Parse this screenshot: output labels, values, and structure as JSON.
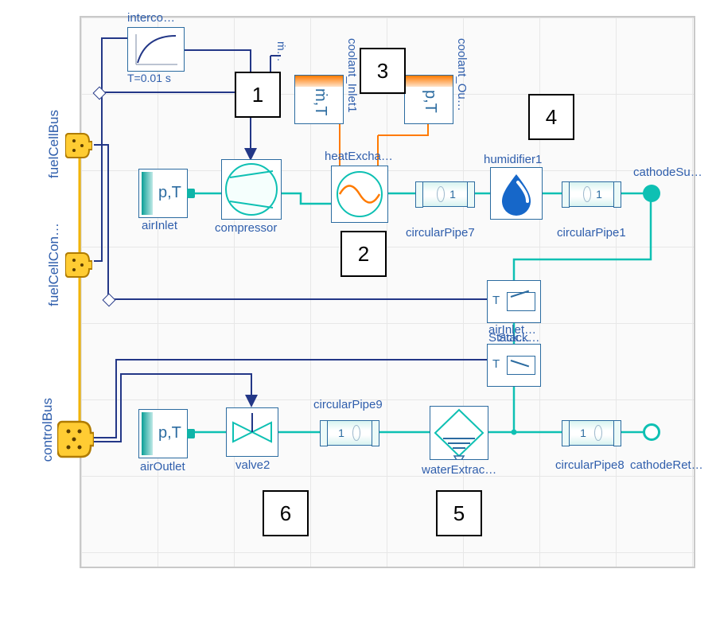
{
  "buses": {
    "fuelCellBus": "fuelCellBus",
    "fuelCellCon": "fuelCellCon…",
    "controlBus": "controlBus"
  },
  "blocks": {
    "interco": {
      "label": "interco…",
      "sub": "T=0.01 s"
    },
    "airInlet": {
      "label": "airInlet",
      "text": "p,T"
    },
    "compressor": {
      "label": "compressor"
    },
    "coolantInlet1": {
      "label": "coolant_Inlet1",
      "text": "ṁ,T",
      "shortText": "ṁ…"
    },
    "coolantOut": {
      "label": "coolant_Ou…",
      "text": "p,T"
    },
    "heatExcha": {
      "label": "heatExcha…"
    },
    "circularPipe7": {
      "label": "circularPipe7",
      "n": "1"
    },
    "humidifier1": {
      "label": "humidifier1"
    },
    "circularPipe1": {
      "label": "circularPipe1",
      "n": "1"
    },
    "cathodeSu": {
      "label": "cathodeSu…"
    },
    "airInletSensor": {
      "label": "airInlet…",
      "T": "T"
    },
    "stackSensor": {
      "label": "Stack…",
      "T": "T"
    },
    "airOutlet": {
      "label": "airOutlet",
      "text": "p,T"
    },
    "valve2": {
      "label": "valve2"
    },
    "circularPipe9": {
      "label": "circularPipe9",
      "n": "1"
    },
    "waterExtrac": {
      "label": "waterExtrac…"
    },
    "circularPipe8": {
      "label": "circularPipe8",
      "n": "1"
    },
    "cathodeRet": {
      "label": "cathodeRet…"
    }
  },
  "annotations": {
    "1": "1",
    "2": "2",
    "3": "3",
    "4": "4",
    "5": "5",
    "6": "6"
  },
  "colors": {
    "signal": "#233787",
    "orangeSignal": "#ff7a00",
    "fluid": "#0ec0b3",
    "busLine": "#f1b300",
    "busFill": "#ffcc33",
    "busEdge": "#b07b00"
  }
}
